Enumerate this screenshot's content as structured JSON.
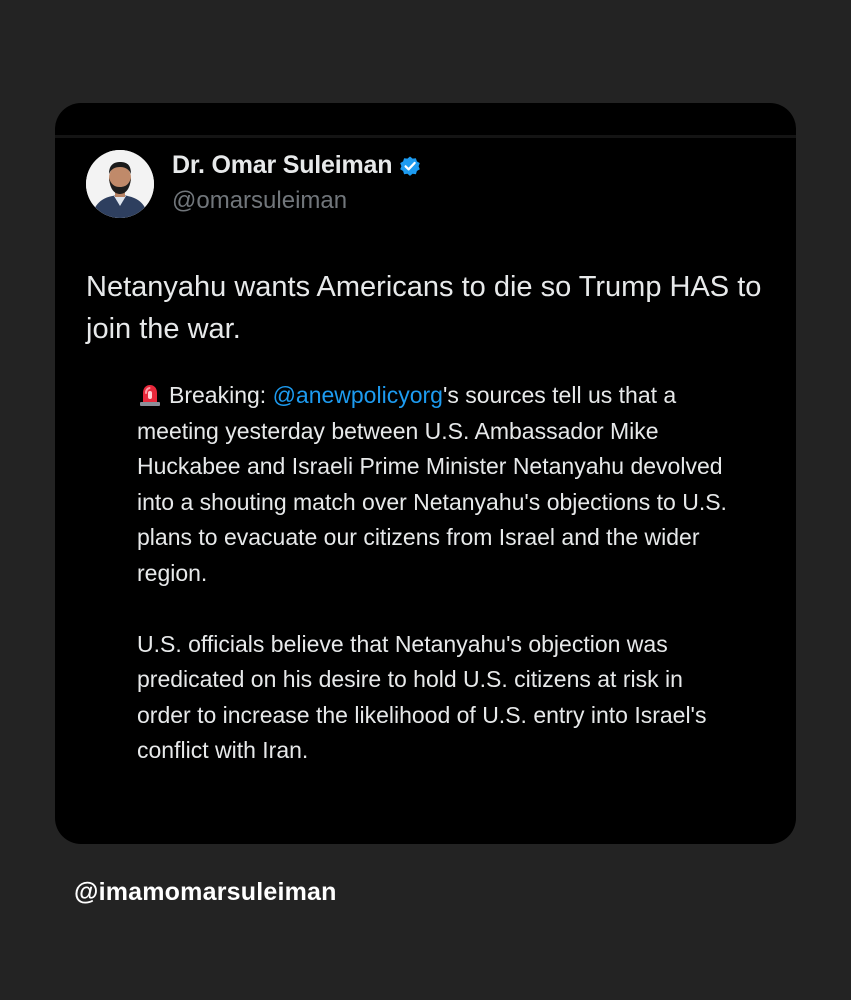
{
  "post": {
    "author_name": "Dr. Omar Suleiman",
    "author_handle": "@omarsuleiman",
    "text": "Netanyahu wants Americans to die so Trump HAS to join the war.",
    "quote": {
      "prefix": "Breaking: ",
      "mention": "@anewpolicyorg",
      "paragraph1_rest": "'s sources tell us that a meeting yesterday between U.S. Ambassador Mike Huckabee and Israeli Prime Minister Netanyahu devolved into a shouting match over Netanyahu's objections to U.S. plans to evacuate our citizens from Israel and the wider region.",
      "paragraph2": "U.S. officials believe that Netanyahu's objection was predicated on his desire to hold U.S. citizens at risk in order to increase the likelihood of U.S. entry into Israel's conflict with Iran."
    }
  },
  "footer": {
    "handle": "@imamomarsuleiman"
  },
  "icons": {
    "verified": "verified-badge-icon",
    "siren": "rotating-light-emoji"
  },
  "colors": {
    "background": "#232323",
    "card": "#000000",
    "text": "#e7e9ea",
    "secondary": "#71767b",
    "accent": "#1d9bf0"
  }
}
